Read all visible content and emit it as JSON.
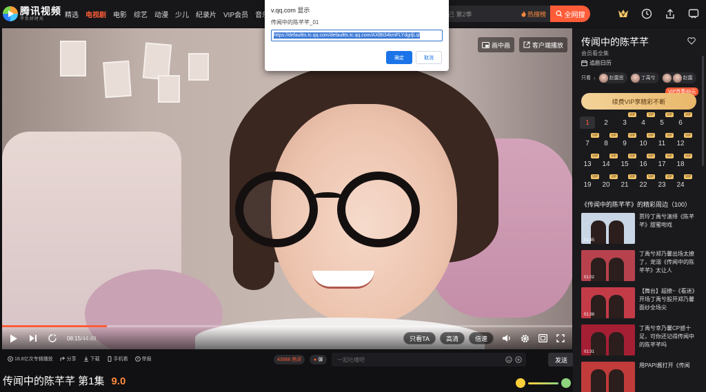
{
  "logo": {
    "name": "腾讯视频",
    "slogan": "不负好时光"
  },
  "nav": [
    "精选",
    "电视剧",
    "电影",
    "综艺",
    "动漫",
    "少儿",
    "纪录片",
    "VIP会员",
    "音乐"
  ],
  "nav_active": 1,
  "search": {
    "placeholder": "己 第2季",
    "hot": "热搜榜",
    "button": "全网搜"
  },
  "player": {
    "pip": "画中画",
    "client": "客户端播放",
    "time_current": "08:15",
    "time_total": "/44:49",
    "progress": 0.184,
    "only_ta": "只看TA",
    "quality": "高清",
    "speed": "倍速"
  },
  "subbar": {
    "views": "18.8亿次专辑播放",
    "share": "分享",
    "download": "下载",
    "mobile": "手机看",
    "report": "举报",
    "danmu_count": "43996 热评",
    "danmu_toggle": "弹",
    "danmu_placeholder": "一起吐槽吧",
    "send": "发送"
  },
  "video_title": "传闻中的陈芊芊 第1集",
  "score": "9.0",
  "sidebar": {
    "title": "传闻中的陈芊芊",
    "sub": "会员看全集",
    "calendar": "追剧日历",
    "only_label": "只看",
    "actors": [
      "赵露思",
      "丁禹兮",
      "赵露"
    ],
    "vip_tag": "VIP首季48元",
    "vip_button": "续费VIP享精彩不断",
    "episodes": [
      "1",
      "2",
      "3",
      "4",
      "5",
      "6",
      "7",
      "8",
      "9",
      "10",
      "11",
      "12",
      "13",
      "14",
      "15",
      "16",
      "17",
      "18",
      "19",
      "20",
      "21",
      "22",
      "23",
      "24"
    ],
    "vip_badge": "VIP",
    "section": "《传闻中的陈芊芊》的精彩周边（100）",
    "clips": [
      {
        "text": "贾玲丁禹兮演绎《陈芊芊》甜蜜吻戏",
        "dur": "01:45"
      },
      {
        "text": "丁禹兮郑乃馨出场太撩了，宠溺《传闻中的陈芊芊》太让人",
        "dur": "01:02"
      },
      {
        "text": "【舞台】超撩~《看迷》开场丁禹兮股开郑乃馨面纱全场尖",
        "dur": "01:38"
      },
      {
        "text": "丁禹兮幸乃馨CP感十足，可你还记得传闻中的陈芊芊吗",
        "dur": "01:31"
      },
      {
        "text": "用PAPI酱打开《传闻",
        "dur": ""
      }
    ]
  },
  "dialog": {
    "title": "v.qq.com 显示",
    "message": "传闻中的陈芊芊_01",
    "value": "https://defaultts.tc.qq.com/defaultts.tc.qq.com/AXlBt34kmFLYdgdjLql",
    "ok": "确定",
    "cancel": "取消"
  },
  "colors": {
    "accent": "#ff5c38",
    "vip_gold": "#f3c56b",
    "dialog_blue": "#1a73e8"
  }
}
